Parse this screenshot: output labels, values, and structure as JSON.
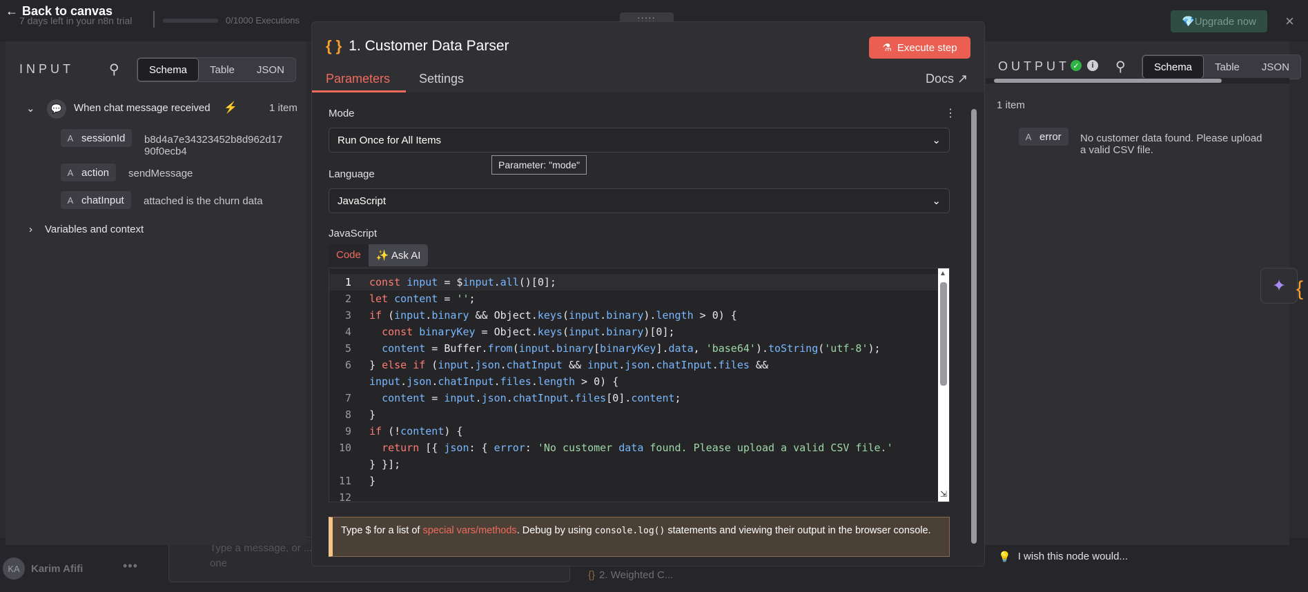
{
  "topbar": {
    "back_label": "Back to canvas",
    "trial_text": "7 days left in your n8n trial",
    "executions": "0/1000 Executions",
    "upgrade_label": "Upgrade now",
    "drag_handle": ":::::",
    "close_symbol": "×"
  },
  "input_panel": {
    "title": "INPUT",
    "view_tabs": [
      "Schema",
      "Table",
      "JSON"
    ],
    "active_tab": "Schema",
    "trigger": {
      "name": "When chat message received",
      "count": "1 item",
      "fields": [
        {
          "type": "A",
          "key": "sessionId",
          "value_line1": "b8d4a7e34323452b8d962d17",
          "value_line2": "90f0ecb4"
        },
        {
          "type": "A",
          "key": "action",
          "value_line1": "sendMessage",
          "value_line2": ""
        },
        {
          "type": "A",
          "key": "chatInput",
          "value_line1": "attached is the churn data",
          "value_line2": ""
        }
      ]
    },
    "variables_label": "Variables and context"
  },
  "dialog": {
    "node_icon": "{ }",
    "node_title": "1. Customer Data Parser",
    "execute_label": "Execute step",
    "tabs": [
      "Parameters",
      "Settings"
    ],
    "active_tab": "Parameters",
    "docs_label": "Docs",
    "mode_label": "Mode",
    "mode_value": "Run Once for All Items",
    "tooltip": "Parameter: \"mode\"",
    "language_label": "Language",
    "language_value": "JavaScript",
    "code_label": "JavaScript",
    "code_tabs": {
      "code": "Code",
      "ask_ai": "Ask AI"
    },
    "code_lines": [
      {
        "n": "1",
        "text": "const input = $input.all()[0];"
      },
      {
        "n": "2",
        "text": "let content = '';"
      },
      {
        "n": "3",
        "text": "if (input.binary && Object.keys(input.binary).length > 0) {"
      },
      {
        "n": "4",
        "text": "  const binaryKey = Object.keys(input.binary)[0];"
      },
      {
        "n": "5",
        "text": "  content = Buffer.from(input.binary[binaryKey].data, 'base64').toString('utf-8');"
      },
      {
        "n": "6",
        "text": "} else if (input.json.chatInput && input.json.chatInput.files &&"
      },
      {
        "n": "",
        "text": "input.json.chatInput.files.length > 0) {"
      },
      {
        "n": "7",
        "text": "  content = input.json.chatInput.files[0].content;"
      },
      {
        "n": "8",
        "text": "}"
      },
      {
        "n": "9",
        "text": "if (!content) {"
      },
      {
        "n": "10",
        "text": "  return [{ json: { error: 'No customer data found. Please upload a valid CSV file.'"
      },
      {
        "n": "",
        "text": "} }];"
      },
      {
        "n": "11",
        "text": "}"
      },
      {
        "n": "12",
        "text": ""
      }
    ],
    "hint": {
      "prefix": "Type $ for a list of ",
      "link": "special vars/methods",
      "middle": ". Debug by using ",
      "code": "console.log()",
      "suffix": " statements and viewing their output in the browser console."
    }
  },
  "output_panel": {
    "title": "OUTPUT",
    "view_tabs": [
      "Schema",
      "Table",
      "JSON"
    ],
    "active_tab": "Schema",
    "count": "1 item",
    "field": {
      "type": "A",
      "key": "error",
      "value_line1": "No customer data found. Please upload",
      "value_line2": "a valid CSV file."
    },
    "feedback": "I wish this node would..."
  },
  "bottom": {
    "user_initials": "KA",
    "user_name": "Karim Afifi",
    "chat_placeholder": "Type a message, or ...",
    "chat_placeholder_2": "one",
    "next_node": "2. Weighted C..."
  },
  "colors": {
    "accent": "#ea5f52",
    "node_icon": "#f5a030",
    "success": "#2fb344"
  }
}
